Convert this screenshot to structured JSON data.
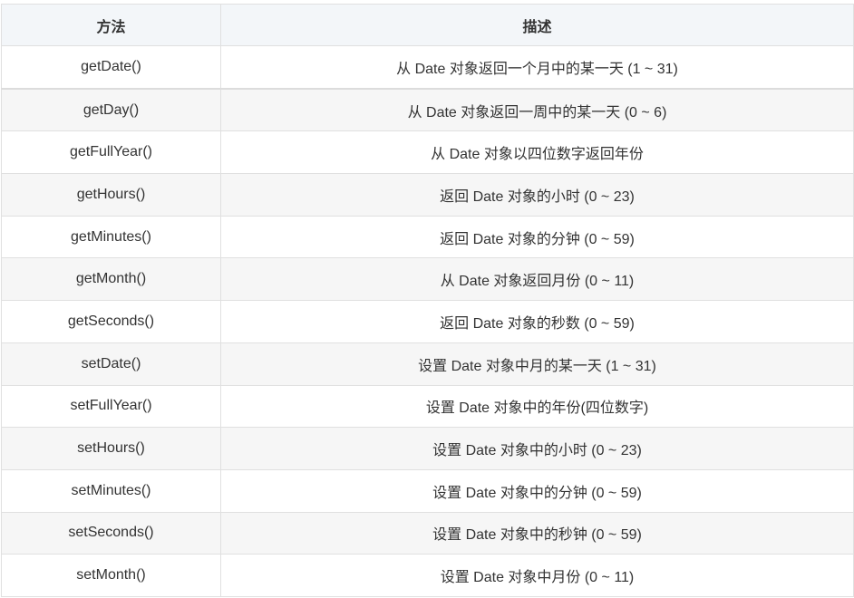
{
  "table": {
    "headers": [
      "方法",
      "描述"
    ],
    "rows": [
      {
        "method": "getDate()",
        "desc": "从 Date 对象返回一个月中的某一天 (1 ~ 31)"
      },
      {
        "method": "getDay()",
        "desc": "从 Date 对象返回一周中的某一天 (0 ~ 6)"
      },
      {
        "method": "getFullYear()",
        "desc": "从 Date 对象以四位数字返回年份"
      },
      {
        "method": "getHours()",
        "desc": "返回 Date 对象的小时 (0 ~ 23)"
      },
      {
        "method": "getMinutes()",
        "desc": "返回 Date 对象的分钟 (0 ~ 59)"
      },
      {
        "method": "getMonth()",
        "desc": "从 Date 对象返回月份 (0 ~ 11)"
      },
      {
        "method": "getSeconds()",
        "desc": "返回 Date 对象的秒数 (0 ~ 59)"
      },
      {
        "method": "setDate()",
        "desc": "设置 Date 对象中月的某一天 (1 ~ 31)"
      },
      {
        "method": "setFullYear()",
        "desc": "设置 Date 对象中的年份(四位数字)"
      },
      {
        "method": "setHours()",
        "desc": "设置 Date 对象中的小时 (0 ~ 23)"
      },
      {
        "method": "setMinutes()",
        "desc": "设置 Date 对象中的分钟 (0 ~ 59)"
      },
      {
        "method": "setSeconds()",
        "desc": "设置 Date 对象中的秒钟 (0 ~ 59)"
      },
      {
        "method": "setMonth()",
        "desc": "设置 Date 对象中月份 (0 ~ 11)"
      }
    ]
  }
}
